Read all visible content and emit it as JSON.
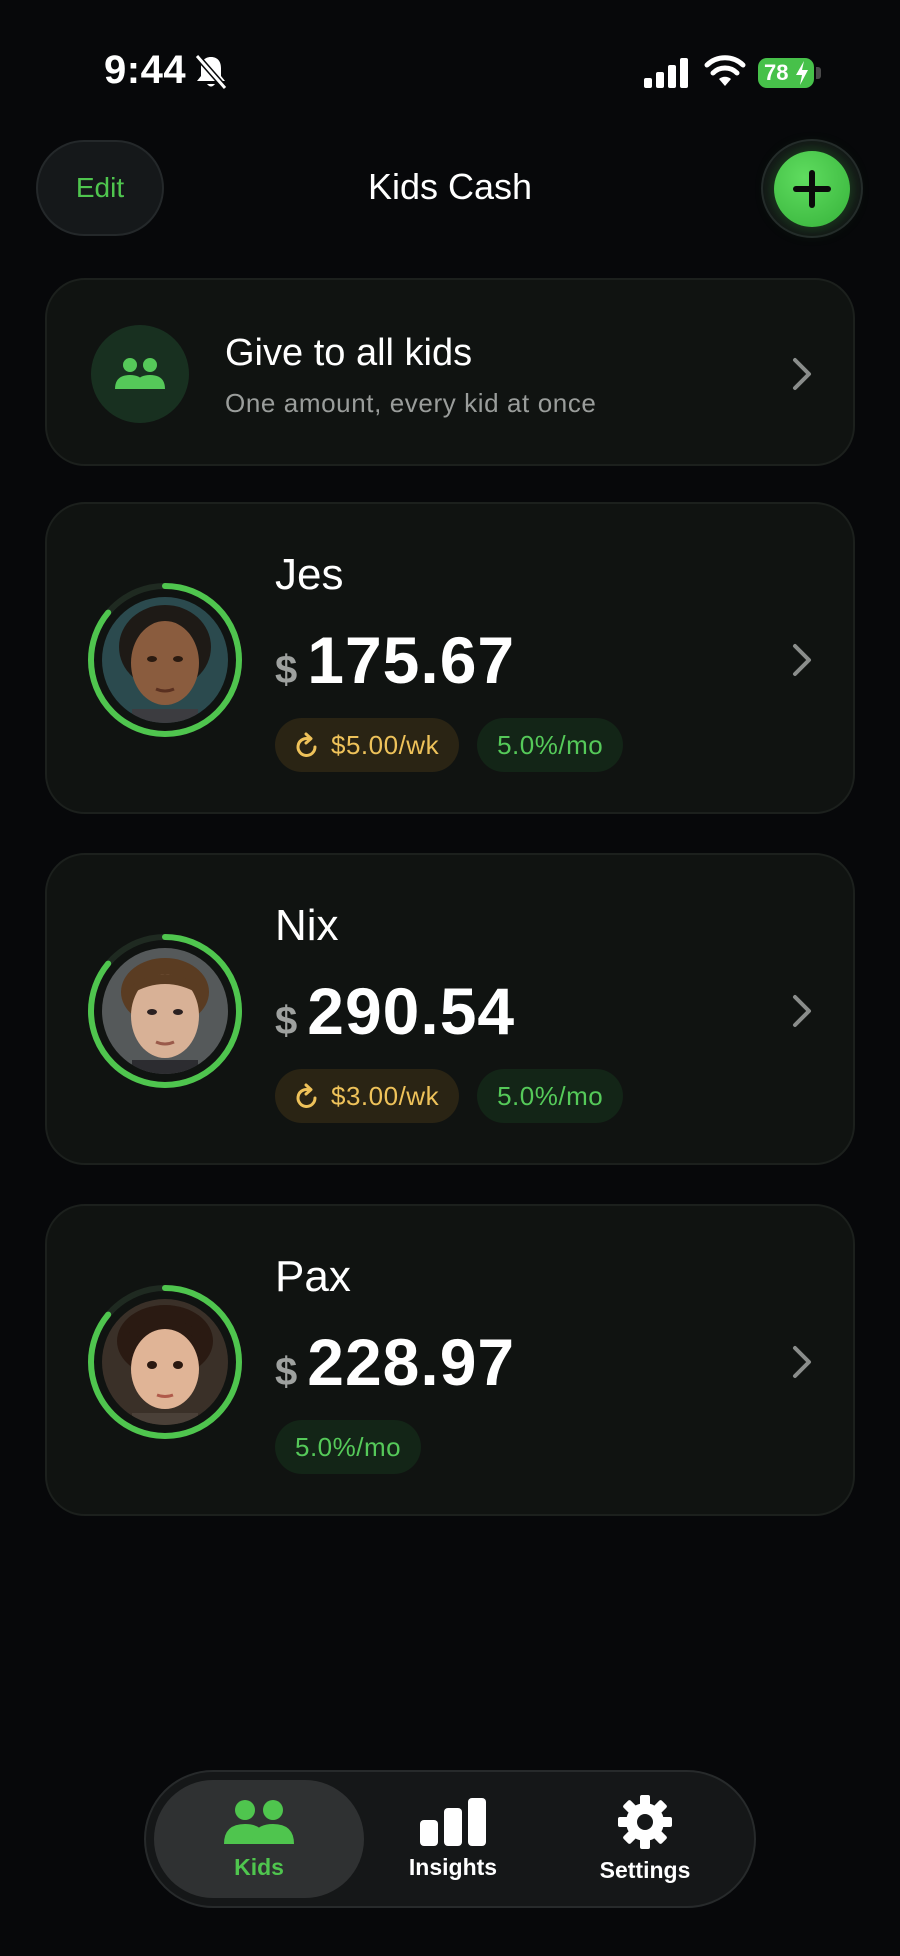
{
  "status_bar": {
    "time": "9:44",
    "battery": "78",
    "icons": [
      "bell-slash-icon",
      "signal-icon",
      "wifi-icon",
      "battery-charging-icon"
    ]
  },
  "header": {
    "edit_label": "Edit",
    "title": "Kids Cash",
    "add_icon": "plus-icon"
  },
  "give_all": {
    "title": "Give to all kids",
    "subtitle": "One amount, every kid at once",
    "icon": "people-icon"
  },
  "kids": [
    {
      "name": "Jes",
      "currency": "$",
      "balance": "175.67",
      "allowance": "$5.00/wk",
      "interest": "5.0%/mo"
    },
    {
      "name": "Nix",
      "currency": "$",
      "balance": "290.54",
      "allowance": "$3.00/wk",
      "interest": "5.0%/mo"
    },
    {
      "name": "Pax",
      "currency": "$",
      "balance": "228.97",
      "interest": "5.0%/mo"
    }
  ],
  "tabbar": {
    "tabs": [
      {
        "label": "Kids",
        "icon": "people-icon",
        "active": true
      },
      {
        "label": "Insights",
        "icon": "bar-chart-icon",
        "active": false
      },
      {
        "label": "Settings",
        "icon": "gear-icon",
        "active": false
      }
    ]
  },
  "colors": {
    "accent_green": "#4fc54e",
    "allowance_gold": "#eec25a",
    "background": "#07080a",
    "card": "#101311"
  }
}
